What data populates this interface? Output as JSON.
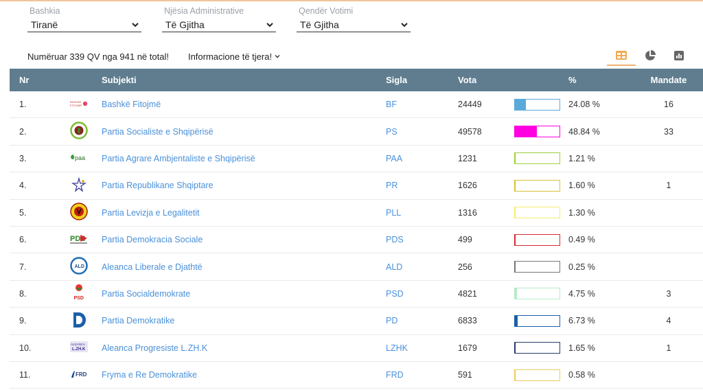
{
  "filters": [
    {
      "label": "Bashkia",
      "value": "Tiranë"
    },
    {
      "label": "Njësia Administrative",
      "value": "Të Gjitha"
    },
    {
      "label": "Qendër Votimi",
      "value": "Të Gjitha"
    }
  ],
  "info": {
    "counted": "Numëruar 339 QV nga 941 në total!",
    "more": "Informacione të tjera!"
  },
  "views": [
    "table-icon",
    "pie-chart-icon",
    "bar-chart-icon"
  ],
  "table": {
    "headers": {
      "nr": "Nr",
      "subject": "Subjekti",
      "sigla": "Sigla",
      "vota": "Vota",
      "pct": "%",
      "mandate": "Mandate"
    },
    "rows": [
      {
        "nr": "1.",
        "name": "Bashkë Fitojmë",
        "sigla": "BF",
        "vota": "24449",
        "pct": "24.08 %",
        "mandate": "16",
        "share": 0.2408,
        "color": "#5aa9db",
        "logo": "BF"
      },
      {
        "nr": "2.",
        "name": "Partia Socialiste e Shqipërisë",
        "sigla": "PS",
        "vota": "49578",
        "pct": "48.84 %",
        "mandate": "33",
        "share": 0.4884,
        "color": "#ff00e0",
        "logo": "PS"
      },
      {
        "nr": "3.",
        "name": "Partia Agrare Ambjentaliste e Shqipërisë",
        "sigla": "PAA",
        "vota": "1231",
        "pct": "1.21 %",
        "mandate": "",
        "share": 0.0121,
        "color": "#9ccf3c",
        "logo": "paa"
      },
      {
        "nr": "4.",
        "name": "Partia Republikane Shqiptare",
        "sigla": "PR",
        "vota": "1626",
        "pct": "1.60 %",
        "mandate": "1",
        "share": 0.016,
        "color": "#d8c03a",
        "logo": "PR"
      },
      {
        "nr": "5.",
        "name": "Partia Levizja e Legalitetit",
        "sigla": "PLL",
        "vota": "1316",
        "pct": "1.30 %",
        "mandate": "",
        "share": 0.013,
        "color": "#f5ee6a",
        "logo": "PLL"
      },
      {
        "nr": "6.",
        "name": "Partia Demokracia Sociale",
        "sigla": "PDS",
        "vota": "499",
        "pct": "0.49 %",
        "mandate": "",
        "share": 0.0049,
        "color": "#d8282e",
        "logo": "PDS"
      },
      {
        "nr": "7.",
        "name": "Aleanca Liberale e Djathtë",
        "sigla": "ALD",
        "vota": "256",
        "pct": "0.25 %",
        "mandate": "",
        "share": 0.0025,
        "color": "#777777",
        "logo": "ALD"
      },
      {
        "nr": "8.",
        "name": "Partia Socialdemokrate",
        "sigla": "PSD",
        "vota": "4821",
        "pct": "4.75 %",
        "mandate": "3",
        "share": 0.0475,
        "color": "#b6ebc7",
        "logo": "PSD"
      },
      {
        "nr": "9.",
        "name": "Partia Demokratike",
        "sigla": "PD",
        "vota": "6833",
        "pct": "6.73 %",
        "mandate": "4",
        "share": 0.0673,
        "color": "#1d5fa8",
        "logo": "PD"
      },
      {
        "nr": "10.",
        "name": "Aleanca Progresiste L.ZH.K",
        "sigla": "LZHK",
        "vota": "1679",
        "pct": "1.65 %",
        "mandate": "1",
        "share": 0.0165,
        "color": "#283a6e",
        "logo": "LZHK"
      },
      {
        "nr": "11.",
        "name": "Fryma e Re Demokratike",
        "sigla": "FRD",
        "vota": "591",
        "pct": "0.58 %",
        "mandate": "",
        "share": 0.0058,
        "color": "#eccb5c",
        "logo": "FRD"
      }
    ]
  }
}
